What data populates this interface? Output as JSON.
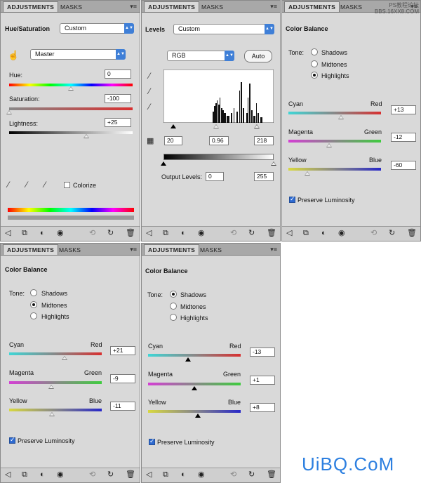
{
  "tabs": {
    "adjustments": "ADJUSTMENTS",
    "masks": "MASKS"
  },
  "watermark_top": {
    "line1": "PS教程论坛",
    "line2": "BBS.16XX8.COM"
  },
  "watermark_bottom": "UiBQ.CoM",
  "hue_sat": {
    "title": "Hue/Saturation",
    "preset": "Custom",
    "channel": "Master",
    "hue_label": "Hue:",
    "hue_value": "0",
    "sat_label": "Saturation:",
    "sat_value": "-100",
    "light_label": "Lightness:",
    "light_value": "+25",
    "colorize_label": "Colorize",
    "colorize_checked": false
  },
  "levels": {
    "title": "Levels",
    "preset": "Custom",
    "channel": "RGB",
    "auto_label": "Auto",
    "input_black": "20",
    "input_gamma": "0.96",
    "input_white": "218",
    "output_label": "Output Levels:",
    "output_black": "0",
    "output_white": "255"
  },
  "cb_highlights": {
    "title": "Color Balance",
    "tone_label": "Tone:",
    "shadows": "Shadows",
    "midtones": "Midtones",
    "highlights": "Highlights",
    "selected": "highlights",
    "cyan": "Cyan",
    "red": "Red",
    "cyan_red": "+13",
    "magenta": "Magenta",
    "green": "Green",
    "magenta_green": "-12",
    "yellow": "Yellow",
    "blue": "Blue",
    "yellow_blue": "-60",
    "preserve": "Preserve Luminosity",
    "preserve_checked": true
  },
  "cb_midtones": {
    "title": "Color Balance",
    "tone_label": "Tone:",
    "shadows": "Shadows",
    "midtones": "Midtones",
    "highlights": "Highlights",
    "selected": "midtones",
    "cyan": "Cyan",
    "red": "Red",
    "cyan_red": "+21",
    "magenta": "Magenta",
    "green": "Green",
    "magenta_green": "-9",
    "yellow": "Yellow",
    "blue": "Blue",
    "yellow_blue": "-11",
    "preserve": "Preserve Luminosity",
    "preserve_checked": true
  },
  "cb_shadows": {
    "title": "Color Balance",
    "tone_label": "Tone:",
    "shadows": "Shadows",
    "midtones": "Midtones",
    "highlights": "Highlights",
    "selected": "shadows",
    "cyan": "Cyan",
    "red": "Red",
    "cyan_red": "-13",
    "magenta": "Magenta",
    "green": "Green",
    "magenta_green": "+1",
    "yellow": "Yellow",
    "blue": "Blue",
    "yellow_blue": "+8",
    "preserve": "Preserve Luminosity",
    "preserve_checked": true
  },
  "colors": {
    "cyan": "#3fd6d6",
    "red": "#d83030",
    "magenta": "#d43fd4",
    "green": "#3fcc3f",
    "yellow": "#d8d840",
    "blue": "#2828c8",
    "accent": "#3f7fd7"
  },
  "icons": [
    "back-arrow-icon",
    "clip-to-layer-icon",
    "mask-icon",
    "visibility-eye-icon",
    "previous-state-icon",
    "reset-icon",
    "delete-icon"
  ]
}
